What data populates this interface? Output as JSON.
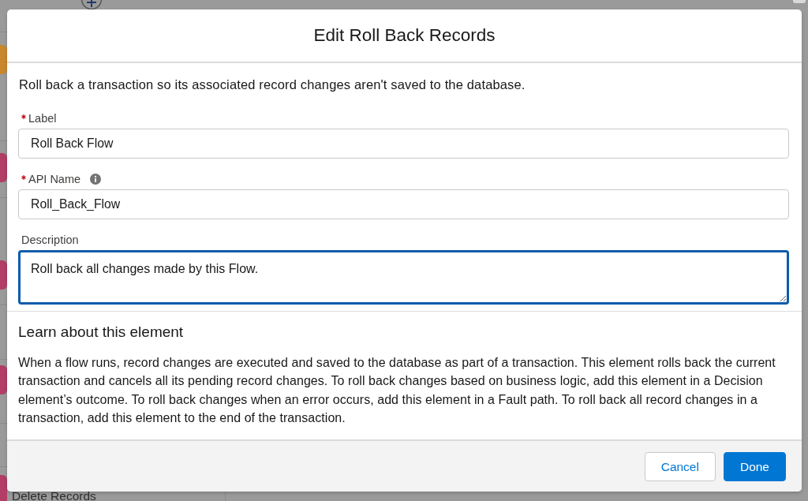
{
  "background": {
    "nodes": [
      {
        "color": "#c8872c"
      },
      {
        "color": "#b23d66"
      },
      {
        "color": "#b23d66"
      },
      {
        "color": "#b23d66"
      },
      {
        "color": "#b23d66",
        "label": "Delete Records"
      }
    ]
  },
  "modal": {
    "title": "Edit Roll Back Records",
    "intro": "Roll back a transaction so its associated record changes aren't saved to the database.",
    "fields": [
      {
        "kind": "input",
        "label": "Label",
        "required": true,
        "info": false,
        "focused": false,
        "value": "Roll Back Flow"
      },
      {
        "kind": "input",
        "label": "API Name",
        "required": true,
        "info": true,
        "focused": false,
        "value": "Roll_Back_Flow"
      },
      {
        "kind": "textarea",
        "label": "Description",
        "required": false,
        "info": false,
        "focused": true,
        "value": "Roll back all changes made by this Flow."
      }
    ],
    "learn": {
      "heading": "Learn about this element",
      "text": "When a flow runs, record changes are executed and saved to the database as part of a transaction. This element rolls back the current transaction and cancels all its pending record changes. To roll back changes based on business logic, add this element in a Decision element’s outcome. To roll back changes when an error occurs, add this element in a Fault path. To roll back all record changes in a transaction, add this element to the end of the transaction."
    },
    "buttons": [
      {
        "label": "Cancel",
        "kind": "neutral"
      },
      {
        "label": "Done",
        "kind": "brand"
      }
    ]
  }
}
